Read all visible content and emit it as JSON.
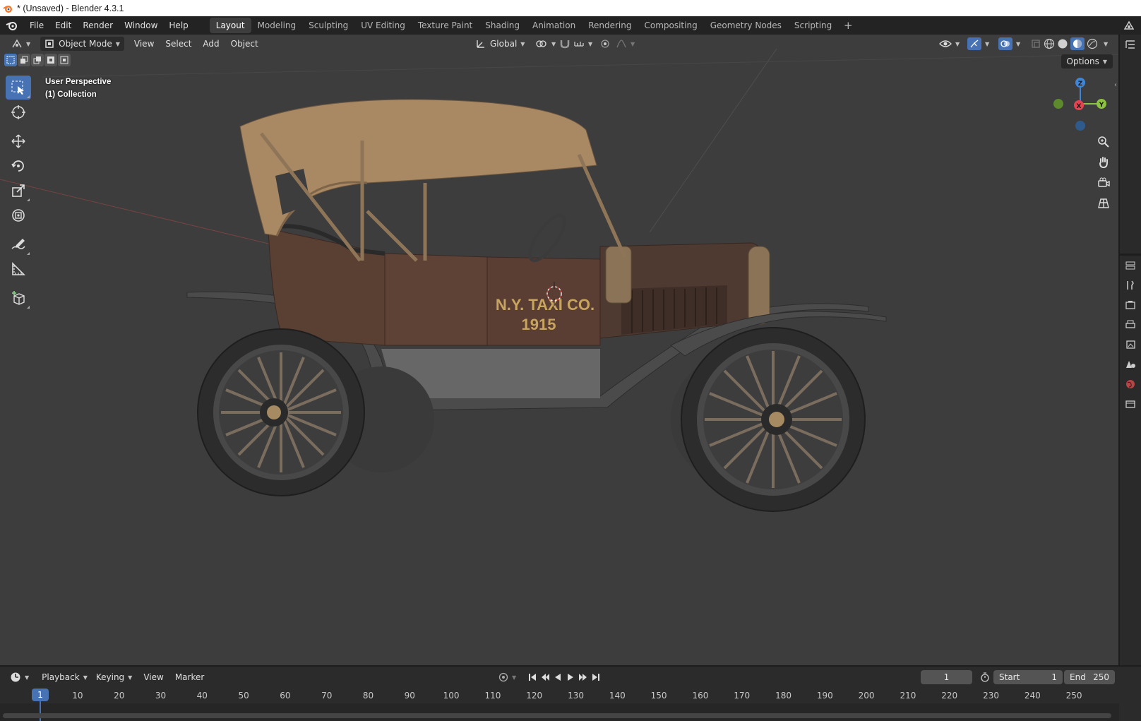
{
  "window": {
    "title": "* (Unsaved) - Blender 4.3.1"
  },
  "topbar": {
    "menus": [
      "File",
      "Edit",
      "Render",
      "Window",
      "Help"
    ],
    "workspaces": [
      "Layout",
      "Modeling",
      "Sculpting",
      "UV Editing",
      "Texture Paint",
      "Shading",
      "Animation",
      "Rendering",
      "Compositing",
      "Geometry Nodes",
      "Scripting"
    ],
    "active_workspace": "Layout",
    "add_workspace": "+"
  },
  "viewport_header": {
    "mode": "Object Mode",
    "menus": [
      "View",
      "Select",
      "Add",
      "Object"
    ],
    "orientation": "Global",
    "options_label": "Options"
  },
  "viewport": {
    "perspective_label": "User Perspective",
    "collection_label": "(1) Collection",
    "car_door_text_line1": "N.Y. TAXI CO.",
    "car_door_text_line2": "1915",
    "gizmo": {
      "x": "X",
      "y": "Y",
      "z": "Z"
    },
    "colors": {
      "background": "#3d3d3d",
      "accent": "#4772b3",
      "axis_x": "#e8414f",
      "axis_y": "#8bc23f",
      "axis_z": "#3f86d9"
    }
  },
  "toolbar": {
    "tools": [
      "select-box",
      "cursor",
      "move",
      "rotate",
      "scale",
      "transform",
      "annotate",
      "measure",
      "add-cube"
    ],
    "active_tool": "select-box"
  },
  "timeline": {
    "menus": [
      "Playback",
      "Keying",
      "View",
      "Marker"
    ],
    "current_frame": "1",
    "start_label": "Start",
    "start_value": "1",
    "end_label": "End",
    "end_value": "250",
    "ruler_ticks": [
      "10",
      "20",
      "30",
      "40",
      "50",
      "60",
      "70",
      "80",
      "90",
      "100",
      "110",
      "120",
      "130",
      "140",
      "150",
      "160",
      "170",
      "180",
      "190",
      "200",
      "210",
      "220",
      "230",
      "240",
      "250"
    ],
    "playhead_label": "1"
  }
}
